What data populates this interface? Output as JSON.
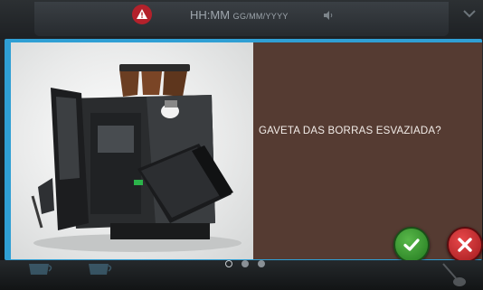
{
  "status_bar": {
    "time": "HH:MM",
    "date": "GG/MM/YYYY"
  },
  "dialog": {
    "question": "GAVETA DAS BORRAS ESVAZIADA?",
    "confirm_icon": "checkmark-icon",
    "cancel_icon": "x-icon"
  },
  "pagination": {
    "pages": 3,
    "current": 1
  },
  "colors": {
    "dialog_border": "#2f9fd4",
    "panel": "#553b32",
    "confirm": "#3c9b32",
    "cancel": "#d32f32",
    "warning": "#b3212b"
  }
}
